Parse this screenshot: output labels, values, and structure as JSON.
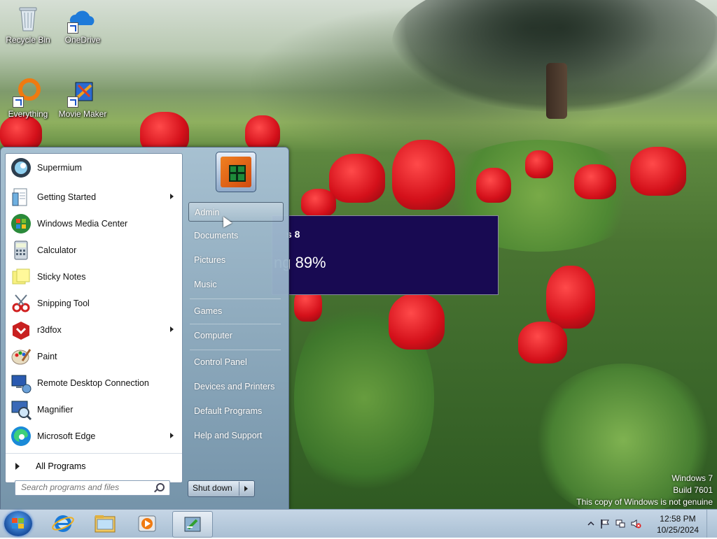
{
  "desktop": {
    "icons": [
      {
        "label": "Recycle Bin",
        "icon": "recycle-bin-icon"
      },
      {
        "label": "OneDrive",
        "icon": "onedrive-cloud-icon"
      },
      {
        "label": "Everything",
        "icon": "everything-search-icon"
      },
      {
        "label": "Movie Maker",
        "icon": "movie-maker-icon"
      }
    ]
  },
  "popup": {
    "title_fragment": "s 8",
    "progress_fragment": "ng 89%",
    "background": "#180a52"
  },
  "watermark": {
    "line1": "Windows 7",
    "line2": "Build 7601",
    "line3": "This copy of Windows is not genuine"
  },
  "start_menu": {
    "programs": [
      {
        "label": "Supermium",
        "icon": "supermium-browser-icon",
        "submenu": false
      },
      {
        "label": "Getting Started",
        "icon": "getting-started-icon",
        "submenu": true
      },
      {
        "label": "Windows Media Center",
        "icon": "windows-media-center-icon",
        "submenu": false
      },
      {
        "label": "Calculator",
        "icon": "calculator-icon",
        "submenu": false
      },
      {
        "label": "Sticky Notes",
        "icon": "sticky-notes-icon",
        "submenu": false
      },
      {
        "label": "Snipping Tool",
        "icon": "snipping-tool-icon",
        "submenu": false
      },
      {
        "label": "r3dfox",
        "icon": "r3dfox-icon",
        "submenu": true
      },
      {
        "label": "Paint",
        "icon": "paint-icon",
        "submenu": false
      },
      {
        "label": "Remote Desktop Connection",
        "icon": "remote-desktop-icon",
        "submenu": false
      },
      {
        "label": "Magnifier",
        "icon": "magnifier-icon",
        "submenu": false
      },
      {
        "label": "Microsoft Edge",
        "icon": "microsoft-edge-icon",
        "submenu": true
      }
    ],
    "all_programs_label": "All Programs",
    "search_placeholder": "Search programs and files",
    "right_items": [
      {
        "label": "Admin",
        "highlighted": true
      },
      {
        "label": "Documents",
        "highlighted": false
      },
      {
        "label": "Pictures",
        "highlighted": false
      },
      {
        "label": "Music",
        "highlighted": false
      },
      {
        "label": "Games",
        "highlighted": false
      },
      {
        "label": "Computer",
        "highlighted": false
      },
      {
        "label": "Control Panel",
        "highlighted": false
      },
      {
        "label": "Devices and Printers",
        "highlighted": false
      },
      {
        "label": "Default Programs",
        "highlighted": false
      },
      {
        "label": "Help and Support",
        "highlighted": false
      }
    ],
    "shutdown_label": "Shut down"
  },
  "taskbar": {
    "pinned": [
      "internet-explorer-icon",
      "file-explorer-icon",
      "media-player-icon",
      "active-app-icon"
    ],
    "tray_icons": [
      "show-hidden-icons-chevron-icon",
      "action-center-flag-icon",
      "network-icon",
      "volume-muted-icon"
    ],
    "time": "12:58 PM",
    "date": "10/25/2024"
  }
}
